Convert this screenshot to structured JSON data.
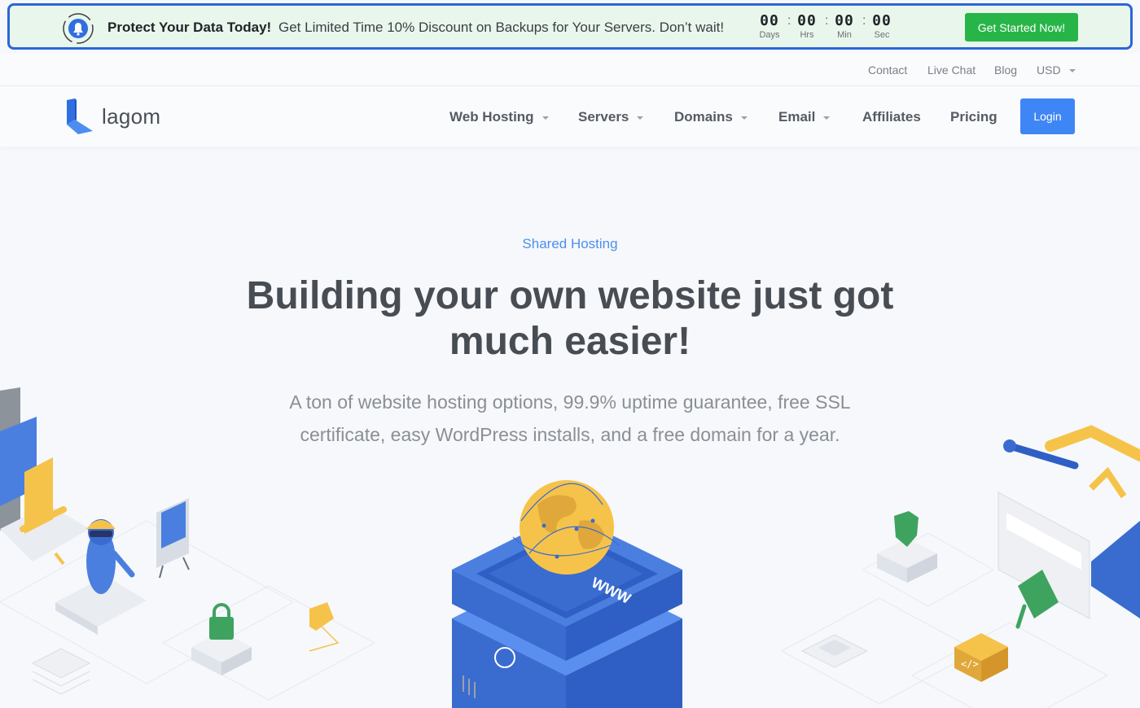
{
  "promo": {
    "title": "Protect Your Data Today!",
    "text": "Get Limited Time 10% Discount on Backups for Your Servers. Don’t wait!",
    "countdown": [
      {
        "value": "00",
        "unit": "Days"
      },
      {
        "value": "00",
        "unit": "Hrs"
      },
      {
        "value": "00",
        "unit": "Min"
      },
      {
        "value": "00",
        "unit": "Sec"
      }
    ],
    "cta_label": "Get Started Now!"
  },
  "toplinks": {
    "contact": "Contact",
    "live_chat": "Live Chat",
    "blog": "Blog",
    "currency": "USD"
  },
  "brand": {
    "name": "lagom"
  },
  "nav": {
    "web_hosting": "Web Hosting",
    "servers": "Servers",
    "domains": "Domains",
    "email": "Email",
    "affiliates": "Affiliates",
    "pricing": "Pricing",
    "login": "Login"
  },
  "hero": {
    "eyebrow": "Shared Hosting",
    "headline": "Building your own website just got much easier!",
    "subtext": "A ton of website hosting options, 99.9% uptime guarantee, free SSL certificate, easy WordPress installs, and a free domain for a year.",
    "badge_text": "WWW"
  },
  "colors": {
    "accent": "#3e86f5",
    "cta_green": "#28b548",
    "banner_border": "#2b66d9",
    "banner_bg": "#e9f6ec"
  },
  "icons": [
    "alarm-bell-icon",
    "lagom-logo-icon",
    "chevron-down-icon"
  ]
}
